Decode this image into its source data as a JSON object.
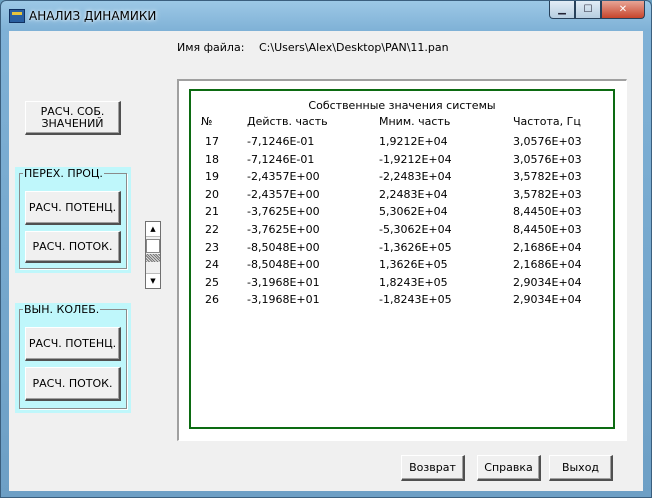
{
  "window": {
    "title": "АНАЛИЗ ДИНАМИКИ"
  },
  "file": {
    "label": "Имя файла:",
    "path": "C:\\Users\\Alex\\Desktop\\PAN\\11.pan"
  },
  "buttons": {
    "eigen": "РАСЧ. СОБ. ЗНАЧЕНИЙ",
    "trans_potential": "РАСЧ. ПОТЕНЦ.",
    "trans_flow": "РАСЧ. ПОТОК.",
    "forced_potential": "РАСЧ. ПОТЕНЦ.",
    "forced_flow": "РАСЧ. ПОТОК.",
    "back": "Возврат",
    "help": "Справка",
    "exit": "Выход"
  },
  "groups": {
    "transient": "ПЕРЕХ. ПРОЦ.",
    "forced": "ВЫН. КОЛЕБ."
  },
  "table": {
    "title": "Собственные значения системы",
    "headers": [
      "№",
      "Действ. часть",
      "Мним. часть",
      "Частота, Гц"
    ],
    "rows": [
      [
        "17",
        "-7,1246E-01",
        "1,9212E+04",
        "3,0576E+03"
      ],
      [
        "18",
        "-7,1246E-01",
        "-1,9212E+04",
        "3,0576E+03"
      ],
      [
        "19",
        "-2,4357E+00",
        "-2,2483E+04",
        "3,5782E+03"
      ],
      [
        "20",
        "-2,4357E+00",
        "2,2483E+04",
        "3,5782E+03"
      ],
      [
        "21",
        "-3,7625E+00",
        "5,3062E+04",
        "8,4450E+03"
      ],
      [
        "22",
        "-3,7625E+00",
        "-5,3062E+04",
        "8,4450E+03"
      ],
      [
        "23",
        "-8,5048E+00",
        "-1,3626E+05",
        "2,1686E+04"
      ],
      [
        "24",
        "-8,5048E+00",
        "1,3626E+05",
        "2,1686E+04"
      ],
      [
        "25",
        "-3,1968E+01",
        "1,8243E+05",
        "2,9034E+04"
      ],
      [
        "26",
        "-3,1968E+01",
        "-1,8243E+05",
        "2,9034E+04"
      ]
    ]
  },
  "icons": {
    "app": "app-icon",
    "minimize": "minimize-icon",
    "maximize": "maximize-icon",
    "close": "close-icon"
  }
}
